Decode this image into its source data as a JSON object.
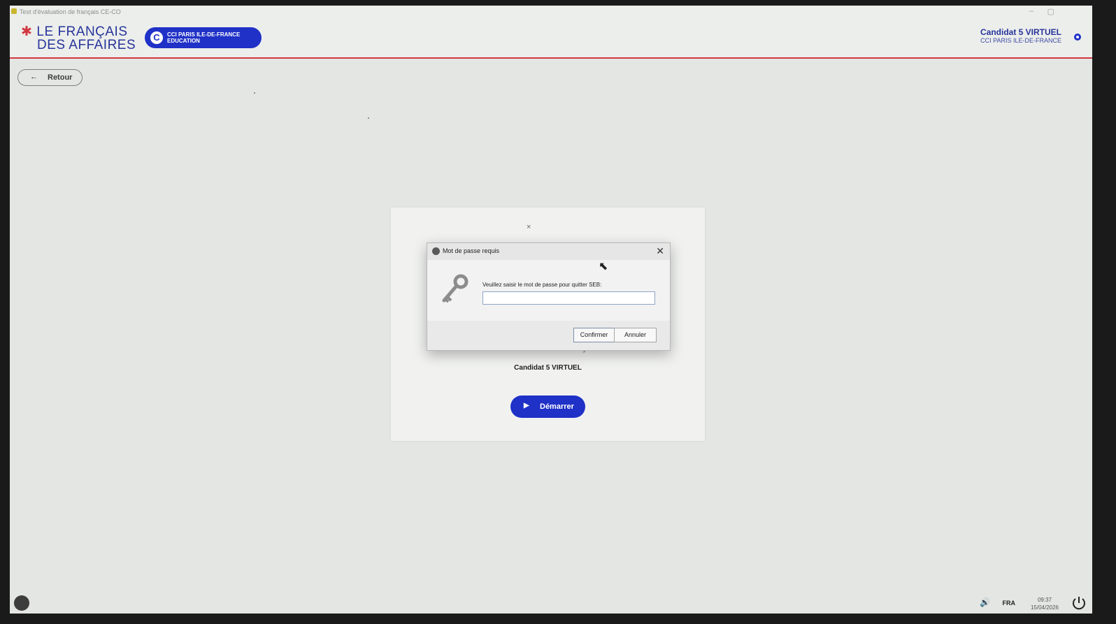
{
  "window": {
    "title": "Test d'évaluation de français CE-CO",
    "minimize_icon": "minimize-icon",
    "restore_icon": "restore-icon"
  },
  "header": {
    "logo_line1": "LE FRANÇAIS",
    "logo_line2": "DES AFFAIRES",
    "logo_star": "✱",
    "partner_badge_line1": "CCI PARIS ILE-DE-FRANCE",
    "partner_badge_line2": "EDUCATION",
    "candidate_name": "Candidat 5 VIRTUEL",
    "candidate_org": "CCI PARIS ILE-DE-FRANCE"
  },
  "nav": {
    "back_label": "Retour",
    "back_icon": "arrow-left-icon"
  },
  "card": {
    "close_glyph": "×",
    "test_title": "Test d'évaluation de français CE-CO",
    "candidate_name": "Candidat 5 VIRTUEL",
    "start_label": "Démarrer",
    "start_icon": "play-icon"
  },
  "dialog": {
    "title": "Mot de passe requis",
    "prompt": "Veuillez saisir le mot de passe pour quitter SEB:",
    "password_value": "",
    "confirm_label": "Confirmer",
    "cancel_label": "Annuler",
    "key_icon": "key-icon"
  },
  "taskbar": {
    "language": "FRA",
    "time": "09:37",
    "date": "15/04/2026"
  },
  "colors": {
    "brand_blue": "#1f31c7",
    "brand_red": "#d2373f",
    "background": "#e4e6e3"
  }
}
